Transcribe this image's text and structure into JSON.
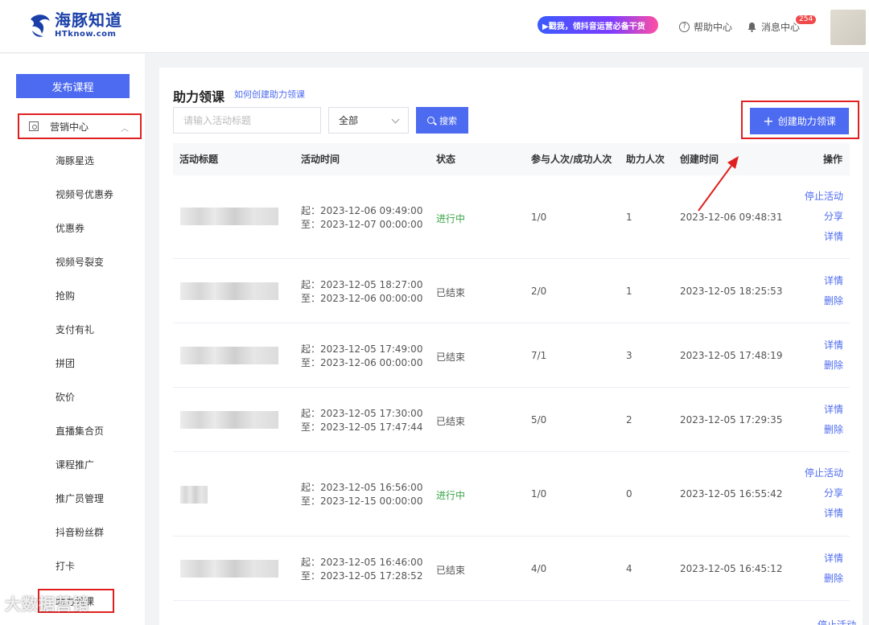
{
  "header": {
    "logo_cn": "海豚知道",
    "logo_en": "HTknow.com",
    "promo": "▶戳我，领抖音运营必备干货",
    "help": "帮助中心",
    "messages": "消息中心",
    "badge": "254"
  },
  "sidebar": {
    "publish": "发布课程",
    "group": "营销中心",
    "items": [
      "海豚星选",
      "视频号优惠券",
      "优惠券",
      "视频号裂变",
      "抢购",
      "支付有礼",
      "拼团",
      "砍价",
      "直播集合页",
      "课程推广",
      "推广员管理",
      "抖音粉丝群",
      "打卡",
      "助力领课"
    ]
  },
  "main": {
    "title": "助力领课",
    "howto_link": "如何创建助力领课",
    "search_placeholder": "请输入活动标题",
    "status_select": "全部",
    "search_button": "搜索",
    "create_button": "创建助力领课",
    "columns": [
      "活动标题",
      "活动时间",
      "状态",
      "参与人次/成功人次",
      "助力人次",
      "创建时间",
      "操作"
    ],
    "rows": [
      {
        "start": "起：2023-12-06 09:49:00",
        "end": "至：2023-12-07 00:00:00",
        "status": "进行中",
        "participants": "1/0",
        "helpers": "1",
        "created": "2023-12-06 09:48:31",
        "ops": [
          "停止活动",
          "分享",
          "详情"
        ]
      },
      {
        "start": "起：2023-12-05 18:27:00",
        "end": "至：2023-12-06 00:00:00",
        "status": "已结束",
        "participants": "2/0",
        "helpers": "1",
        "created": "2023-12-05 18:25:53",
        "ops": [
          "详情",
          "删除"
        ]
      },
      {
        "start": "起：2023-12-05 17:49:00",
        "end": "至：2023-12-06 00:00:00",
        "status": "已结束",
        "participants": "7/1",
        "helpers": "3",
        "created": "2023-12-05 17:48:19",
        "ops": [
          "详情",
          "删除"
        ]
      },
      {
        "start": "起：2023-12-05 17:30:00",
        "end": "至：2023-12-05 17:47:44",
        "status": "已结束",
        "participants": "5/0",
        "helpers": "2",
        "created": "2023-12-05 17:29:35",
        "ops": [
          "详情",
          "删除"
        ]
      },
      {
        "start": "起：2023-12-05 16:56:00",
        "end": "至：2023-12-15 00:00:00",
        "status": "进行中",
        "participants": "1/0",
        "helpers": "0",
        "created": "2023-12-05 16:55:42",
        "ops": [
          "停止活动",
          "分享",
          "详情"
        ]
      },
      {
        "start": "起：2023-12-05 16:46:00",
        "end": "至：2023-12-05 17:28:52",
        "status": "已结束",
        "participants": "4/0",
        "helpers": "4",
        "created": "2023-12-05 16:45:12",
        "ops": [
          "详情",
          "删除"
        ]
      }
    ],
    "partial_op": "停止活动"
  },
  "watermark": "大数据营销",
  "colors": {
    "accent": "#4d6bf0",
    "active_status": "#3aa64a",
    "annotation": "#e02020"
  }
}
